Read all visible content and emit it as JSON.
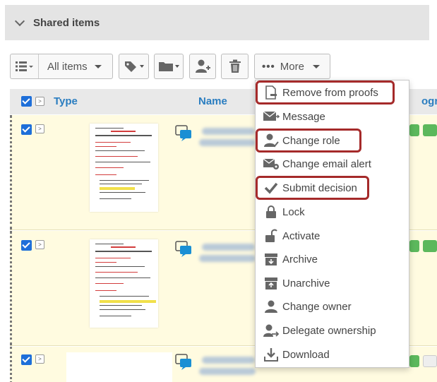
{
  "section": {
    "title": "Shared items"
  },
  "toolbar": {
    "filter_label": "All items",
    "more_label": "More"
  },
  "grid": {
    "columns": {
      "type": "Type",
      "name": "Name",
      "progress": "ogr"
    }
  },
  "menu": {
    "items": [
      {
        "label": "Remove from proofs",
        "icon": "remove-document-icon",
        "highlighted": true
      },
      {
        "label": "Message",
        "icon": "envelope-icon",
        "highlighted": false
      },
      {
        "label": "Change role",
        "icon": "user-role-icon",
        "highlighted": true
      },
      {
        "label": "Change email alert",
        "icon": "email-alert-icon",
        "highlighted": false
      },
      {
        "label": "Submit decision",
        "icon": "checkmark-icon",
        "highlighted": true
      },
      {
        "label": "Lock",
        "icon": "lock-icon",
        "highlighted": false
      },
      {
        "label": "Activate",
        "icon": "unlock-icon",
        "highlighted": false
      },
      {
        "label": "Archive",
        "icon": "archive-icon",
        "highlighted": false
      },
      {
        "label": "Unarchive",
        "icon": "unarchive-icon",
        "highlighted": false
      },
      {
        "label": "Change owner",
        "icon": "owner-icon",
        "highlighted": false
      },
      {
        "label": "Delegate ownership",
        "icon": "delegate-icon",
        "highlighted": false
      },
      {
        "label": "Download",
        "icon": "download-icon",
        "highlighted": false
      }
    ]
  },
  "colors": {
    "highlight_border": "#a52a2a",
    "link_blue": "#2a7dc0",
    "row_background": "#fffbe0",
    "checkbox_blue": "#1e6fd9",
    "status_green": "#5cb85c"
  }
}
